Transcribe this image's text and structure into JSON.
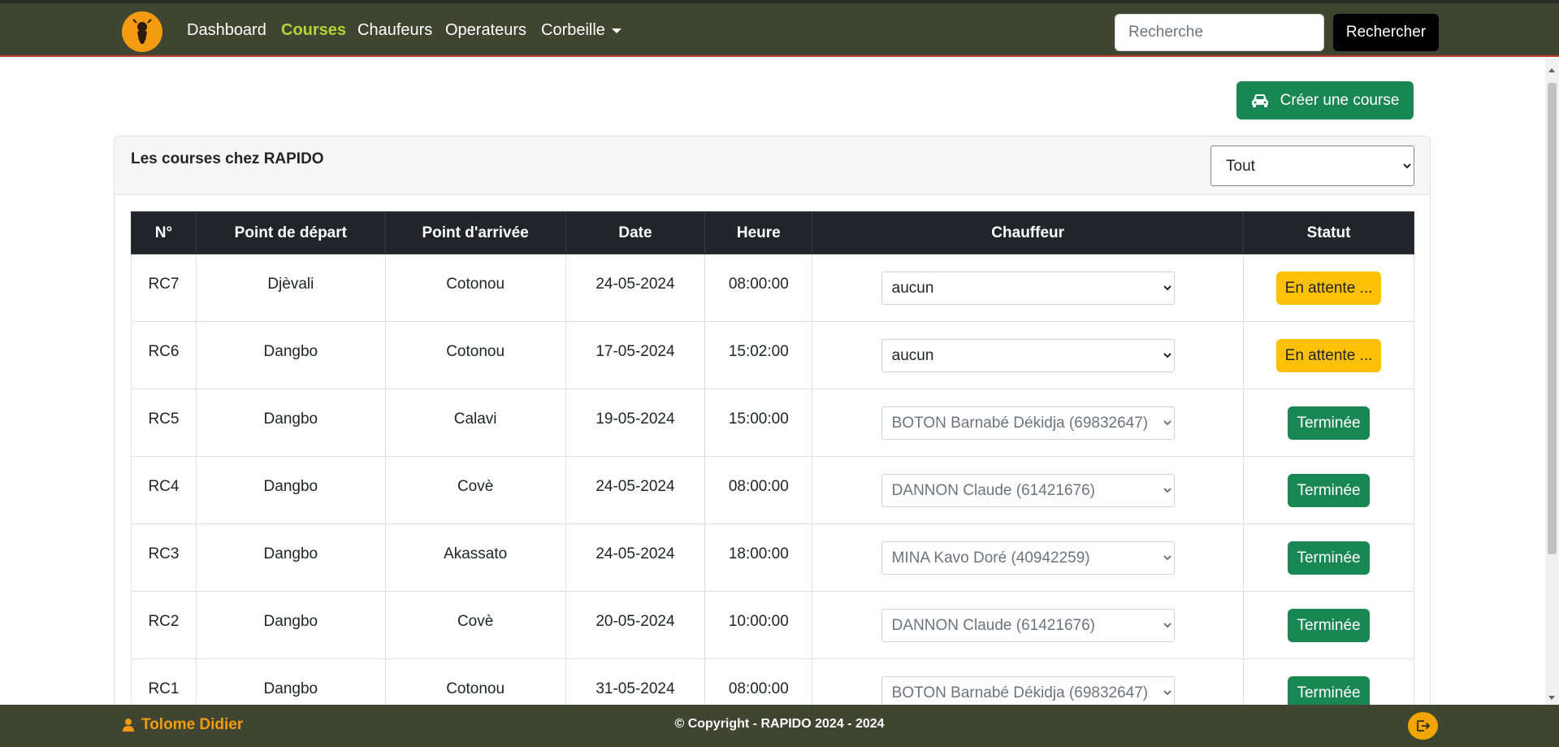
{
  "nav": {
    "links": [
      "Dashboard",
      "Courses",
      "Chaufeurs",
      "Operateurs",
      "Corbeille"
    ],
    "search_placeholder": "Recherche",
    "search_button": "Rechercher"
  },
  "actions": {
    "create_label": "Créer une course"
  },
  "card": {
    "title": "Les courses chez RAPIDO",
    "filter_value": "Tout"
  },
  "table": {
    "headers": [
      "N°",
      "Point de départ",
      "Point d'arrivée",
      "Date",
      "Heure",
      "Chauffeur",
      "Statut"
    ],
    "rows": [
      {
        "num": "RC7",
        "from": "Djèvali",
        "to": "Cotonou",
        "date": "24-05-2024",
        "time": "08:00:00",
        "driver": "aucun",
        "status": "En attente ..."
      },
      {
        "num": "RC6",
        "from": "Dangbo",
        "to": "Cotonou",
        "date": "17-05-2024",
        "time": "15:02:00",
        "driver": "aucun",
        "status": "En attente ..."
      },
      {
        "num": "RC5",
        "from": "Dangbo",
        "to": "Calavi",
        "date": "19-05-2024",
        "time": "15:00:00",
        "driver": "BOTON Barnabé Dékidja (69832647)",
        "status": "Terminée"
      },
      {
        "num": "RC4",
        "from": "Dangbo",
        "to": "Covè",
        "date": "24-05-2024",
        "time": "08:00:00",
        "driver": "DANNON Claude (61421676)",
        "status": "Terminée"
      },
      {
        "num": "RC3",
        "from": "Dangbo",
        "to": "Akassato",
        "date": "24-05-2024",
        "time": "18:00:00",
        "driver": "MINA Kavo Doré (40942259)",
        "status": "Terminée"
      },
      {
        "num": "RC2",
        "from": "Dangbo",
        "to": "Covè",
        "date": "20-05-2024",
        "time": "10:00:00",
        "driver": "DANNON Claude (61421676)",
        "status": "Terminée"
      },
      {
        "num": "RC1",
        "from": "Dangbo",
        "to": "Cotonou",
        "date": "31-05-2024",
        "time": "08:00:00",
        "driver": "BOTON Barnabé Dékidja (69832647)",
        "status": "Terminée"
      }
    ]
  },
  "footer": {
    "user": "Tolome Didier",
    "copyright": "© Copyright - RAPIDO 2024 - 2024"
  },
  "colors": {
    "navbar": "#3f4530",
    "active_link": "#b5d334",
    "success": "#198754",
    "warning": "#ffc107",
    "accent_orange": "#f39c12"
  }
}
